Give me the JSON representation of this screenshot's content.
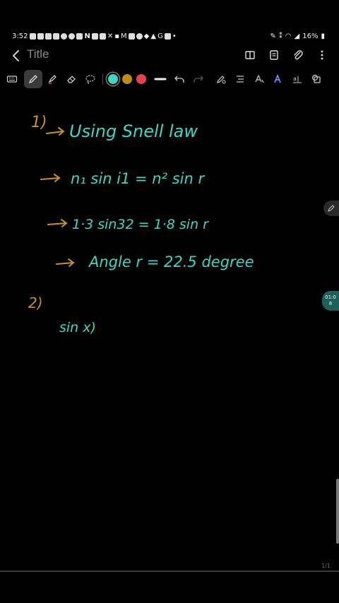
{
  "status_bar": {
    "time": "3:52",
    "battery": "16%"
  },
  "header": {
    "title": "Title"
  },
  "toolbar": {
    "colors": [
      "#3fd6c6",
      "#c08a17",
      "#e8424a"
    ]
  },
  "notes": {
    "item1_number": "1)",
    "line1": "Using Snell law",
    "line2": "n₁ sin i1 = n² sin r",
    "line3": "1·3 sin32 = 1·8 sin r",
    "line4": "Angle r = 22.5 degree",
    "item2_number": "2)",
    "line5": "sin x)"
  },
  "side": {
    "timer_top": "01:0",
    "timer_bottom": "8"
  },
  "page_indicator": "1/1"
}
